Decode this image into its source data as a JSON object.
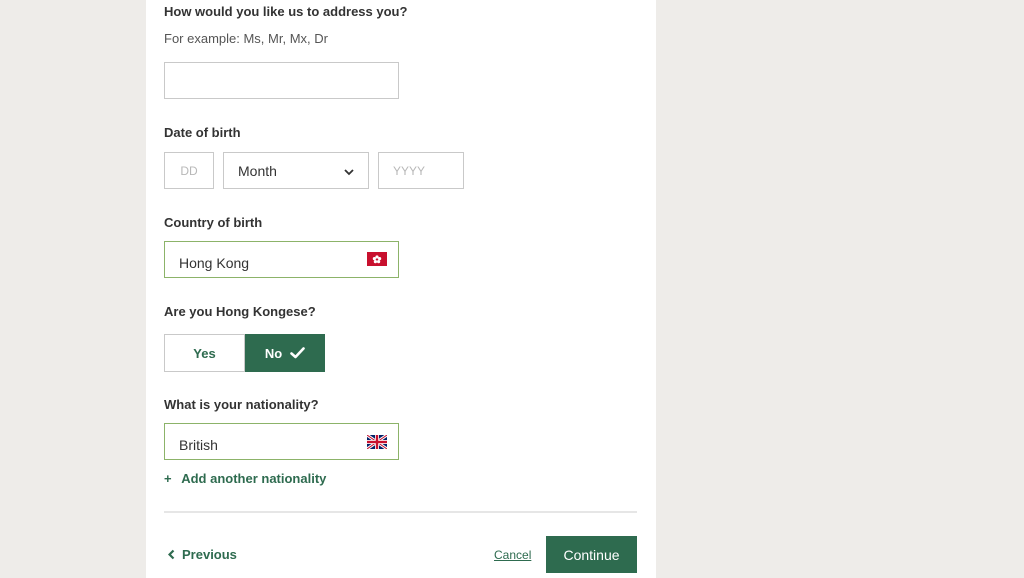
{
  "form": {
    "title_question": "How would you like us to address you?",
    "title_hint": "For example: Ms, Mr, Mx, Dr",
    "title_value": "",
    "dob_label": "Date of birth",
    "dob_day_placeholder": "DD",
    "dob_month_value": "Month",
    "dob_year_placeholder": "YYYY",
    "country_label": "Country of birth",
    "country_value": "Hong Kong",
    "country_flag_icon": "hong-kong-flag-icon",
    "citizen_question": "Are you Hong Kongese?",
    "citizen_yes": "Yes",
    "citizen_no": "No",
    "citizen_selected": "No",
    "nationality_label": "What is your nationality?",
    "nationality_value": "British",
    "nationality_flag_icon": "uk-flag-icon",
    "add_nationality_plus": "+",
    "add_nationality": "Add another nationality"
  },
  "footer": {
    "previous": "Previous",
    "cancel": "Cancel",
    "continue": "Continue"
  },
  "colors": {
    "brand_green": "#2e6b4f",
    "valid_border": "#8cb369",
    "page_background": "#eeece9"
  }
}
